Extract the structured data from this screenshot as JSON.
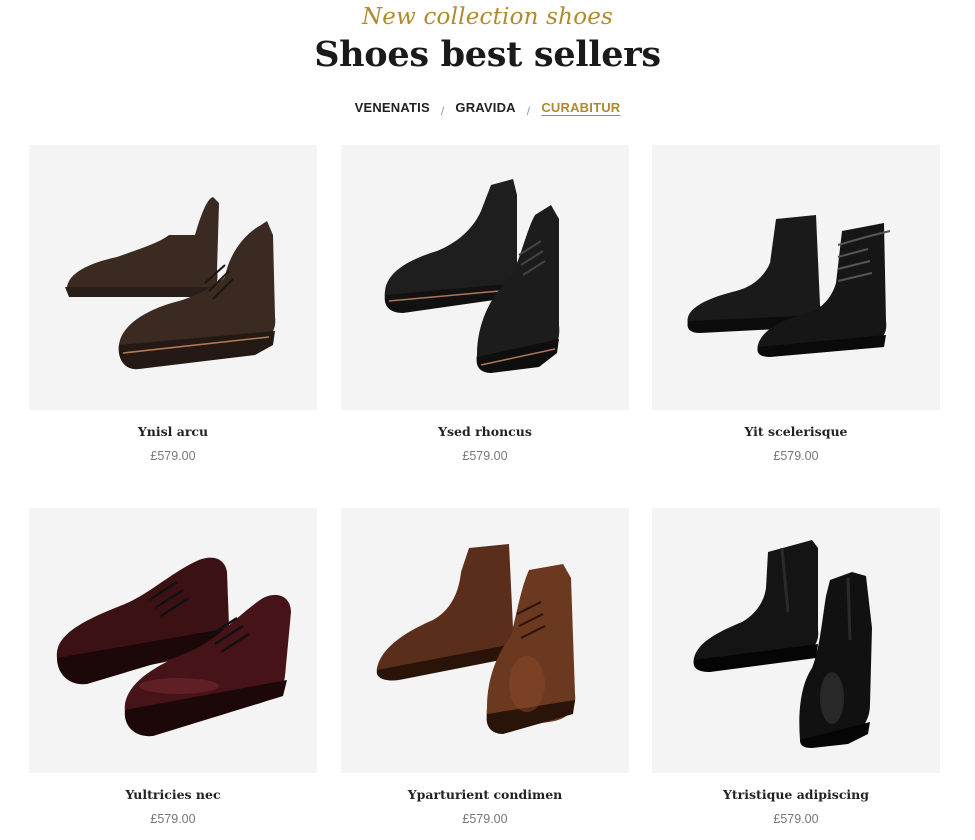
{
  "section": {
    "subtitle": "New collection shoes",
    "title": "Shoes best sellers"
  },
  "tabs": [
    {
      "label": "VENENATIS",
      "active": false
    },
    {
      "label": "GRAVIDA",
      "active": false
    },
    {
      "label": "CURABITUR",
      "active": true
    }
  ],
  "tab_separator": "/",
  "products": [
    {
      "name": "Ynisl arcu",
      "price": "£579.00",
      "image": "brown-suede-chukka-boots",
      "color": "#3a2a22"
    },
    {
      "name": "Ysed rhoncus",
      "price": "£579.00",
      "image": "black-nubuck-chukka-boots",
      "color": "#1c1c1c"
    },
    {
      "name": "Yit scelerisque",
      "price": "£579.00",
      "image": "black-lace-up-boots",
      "color": "#161616"
    },
    {
      "name": "Yultricies nec",
      "price": "£579.00",
      "image": "burgundy-leather-derby-shoes",
      "color": "#3b1114"
    },
    {
      "name": "Yparturient condimen",
      "price": "£579.00",
      "image": "brown-leather-chukka-boots",
      "color": "#5a2e1a"
    },
    {
      "name": "Ytristique adipiscing",
      "price": "£579.00",
      "image": "black-chelsea-boots",
      "color": "#0f0f0f"
    }
  ]
}
